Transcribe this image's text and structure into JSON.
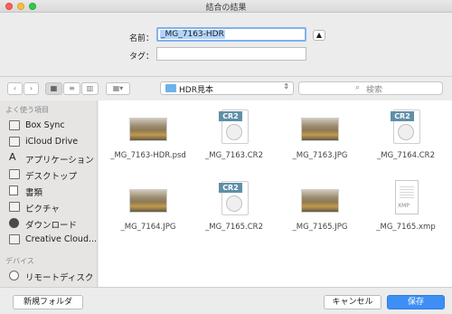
{
  "window": {
    "title": "結合の結果"
  },
  "form": {
    "name_label": "名前：",
    "name_value": "_MG_7163-HDR",
    "tag_label": "タグ：",
    "tag_value": ""
  },
  "toolbar": {
    "location": "HDR見本",
    "search_placeholder": "検索"
  },
  "sidebar": {
    "favorites_header": "よく使う項目",
    "favorites": [
      {
        "label": "Box Sync",
        "icon": "folder-icon"
      },
      {
        "label": "iCloud Drive",
        "icon": "cloud-icon"
      },
      {
        "label": "アプリケーション",
        "icon": "applications-icon"
      },
      {
        "label": "デスクトップ",
        "icon": "desktop-icon"
      },
      {
        "label": "書類",
        "icon": "documents-icon"
      },
      {
        "label": "ピクチャ",
        "icon": "pictures-icon"
      },
      {
        "label": "ダウンロード",
        "icon": "downloads-icon"
      },
      {
        "label": "Creative Cloud...",
        "icon": "folder-icon"
      }
    ],
    "devices_header": "デバイス",
    "devices": [
      {
        "label": "リモートディスク",
        "icon": "disk-icon"
      }
    ]
  },
  "files": [
    {
      "name": "_MG_7163-HDR.psd",
      "kind": "image"
    },
    {
      "name": "_MG_7163.CR2",
      "kind": "raw",
      "tag": "CR2"
    },
    {
      "name": "_MG_7163.JPG",
      "kind": "image"
    },
    {
      "name": "_MG_7164.CR2",
      "kind": "raw",
      "tag": "CR2"
    },
    {
      "name": "_MG_7164.JPG",
      "kind": "image"
    },
    {
      "name": "_MG_7165.CR2",
      "kind": "raw",
      "tag": "CR2"
    },
    {
      "name": "_MG_7165.JPG",
      "kind": "image"
    },
    {
      "name": "_MG_7165.xmp",
      "kind": "xmp",
      "tag": "XMP"
    }
  ],
  "buttons": {
    "new_folder": "新規フォルダ",
    "cancel": "キャンセル",
    "save": "保存"
  },
  "colors": {
    "accent": "#3e8ff5",
    "raw_badge": "#5f8fa8"
  }
}
